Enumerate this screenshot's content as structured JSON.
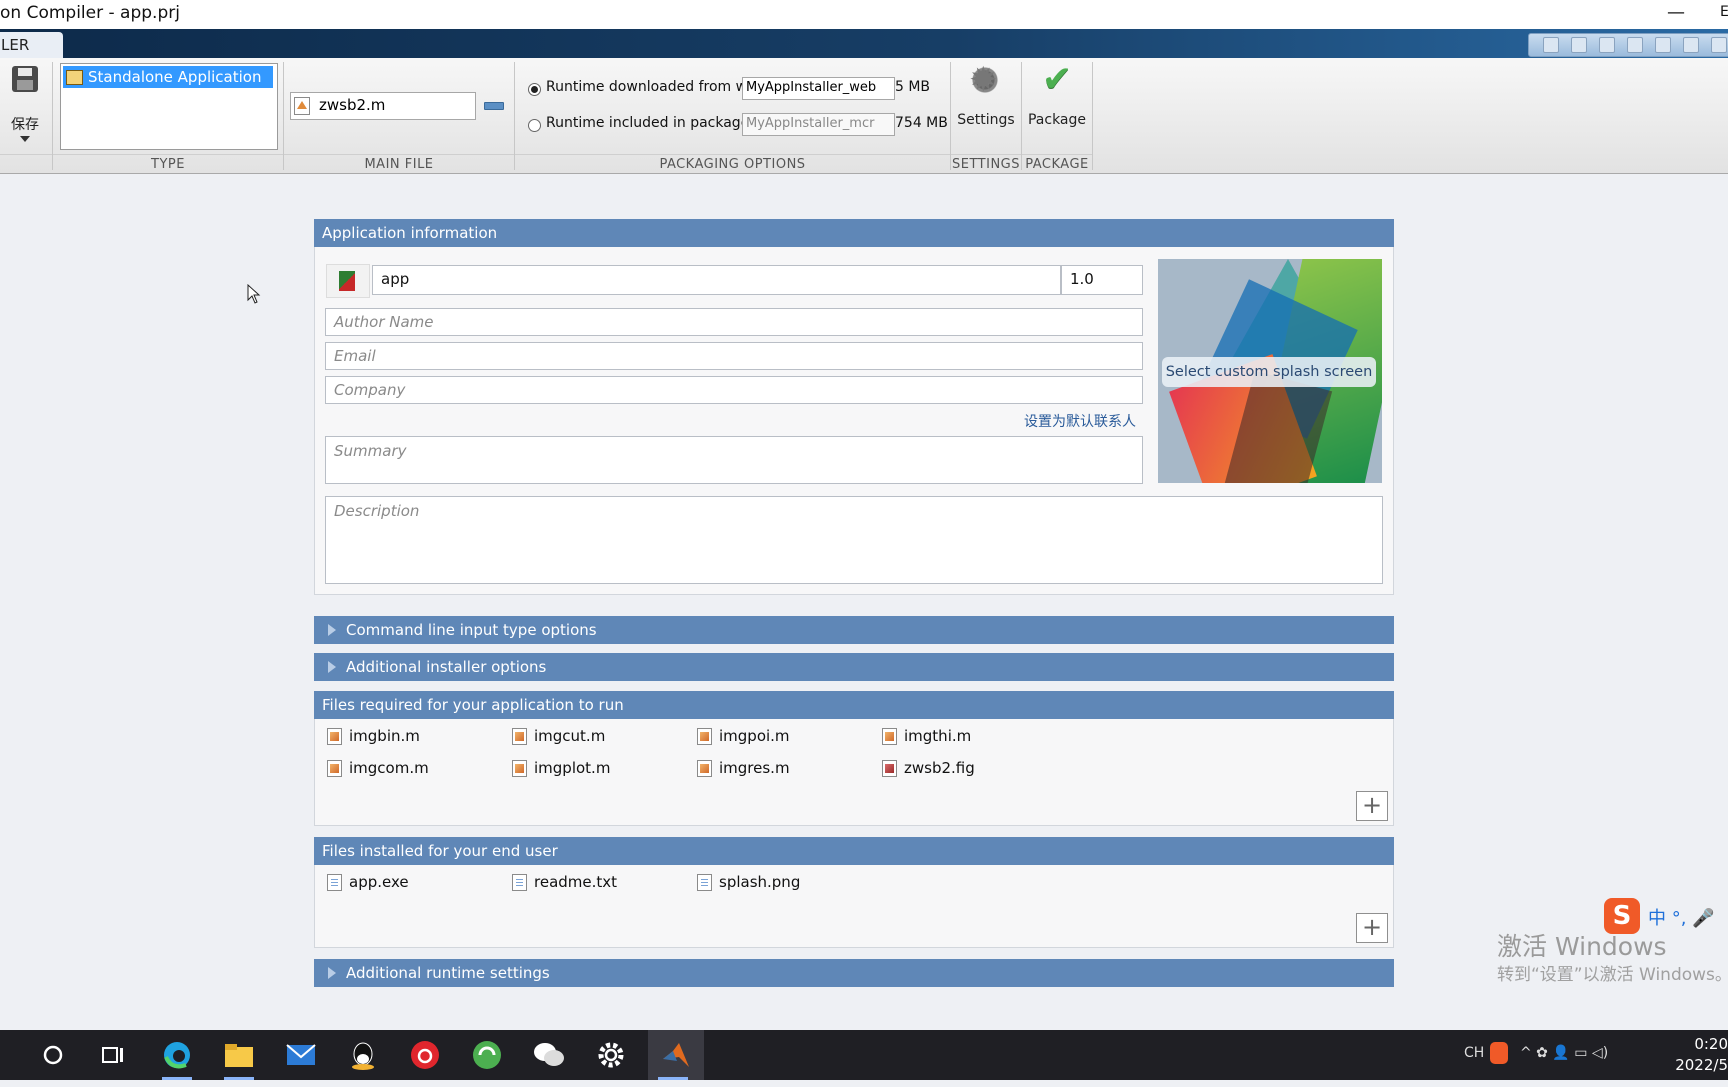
{
  "window": {
    "title": "on Compiler - app.prj",
    "minimize_glyph": "—",
    "close_glyph": "E"
  },
  "ribbon_tab": {
    "label": "LER"
  },
  "ribbon": {
    "save_label": "保存",
    "groups": {
      "type": "TYPE",
      "main_file": "MAIN FILE",
      "packaging": "PACKAGING OPTIONS",
      "settings": "SETTINGS",
      "package": "PACKAGE"
    },
    "type_selected": "Standalone Application",
    "main_file": "zwsb2.m",
    "runtime_web": {
      "label": "Runtime downloaded from web",
      "value": "MyAppInstaller_web",
      "size": "5 MB",
      "selected": true
    },
    "runtime_pkg": {
      "label": "Runtime included in package",
      "value": "MyAppInstaller_mcr",
      "size": "754 MB",
      "selected": false
    },
    "settings_label": "Settings",
    "package_label": "Package"
  },
  "app_info": {
    "header": "Application information",
    "name": "app",
    "version": "1.0",
    "author_placeholder": "Author Name",
    "email_placeholder": "Email",
    "company_placeholder": "Company",
    "set_default_contact": "设置为默认联系人",
    "summary_placeholder": "Summary",
    "description_placeholder": "Description",
    "splash_caption": "Select custom splash screen"
  },
  "sections": {
    "cmdline": "Command line input type options",
    "installer": "Additional installer options",
    "required": "Files required for your application to run",
    "installed": "Files installed for your end user",
    "runtime": "Additional runtime settings"
  },
  "required_files": [
    {
      "name": "imgbin.m",
      "kind": "m"
    },
    {
      "name": "imgcut.m",
      "kind": "m"
    },
    {
      "name": "imgpoi.m",
      "kind": "m"
    },
    {
      "name": "imgthi.m",
      "kind": "m"
    },
    {
      "name": "imgcom.m",
      "kind": "m"
    },
    {
      "name": "imgplot.m",
      "kind": "m"
    },
    {
      "name": "imgres.m",
      "kind": "m"
    },
    {
      "name": "zwsb2.fig",
      "kind": "fig"
    }
  ],
  "installed_files": [
    {
      "name": "app.exe",
      "kind": "doc"
    },
    {
      "name": "readme.txt",
      "kind": "doc"
    },
    {
      "name": "splash.png",
      "kind": "doc"
    }
  ],
  "add_glyph": "+",
  "watermark": {
    "line1": "激活 Windows",
    "line2": "转到“设置”以激活 Windows。"
  },
  "ime": {
    "logo": "S",
    "text": "中 °, 🎤"
  },
  "taskbar": {
    "tray_lang": "CH",
    "tray_icons": "^ ✿ 👤 ▭ ◁)",
    "time": "0:20",
    "date": "2022/5"
  },
  "colors": {
    "panel_header": "#5f87b7",
    "selection": "#3399ff",
    "link": "#2a5b9a"
  }
}
